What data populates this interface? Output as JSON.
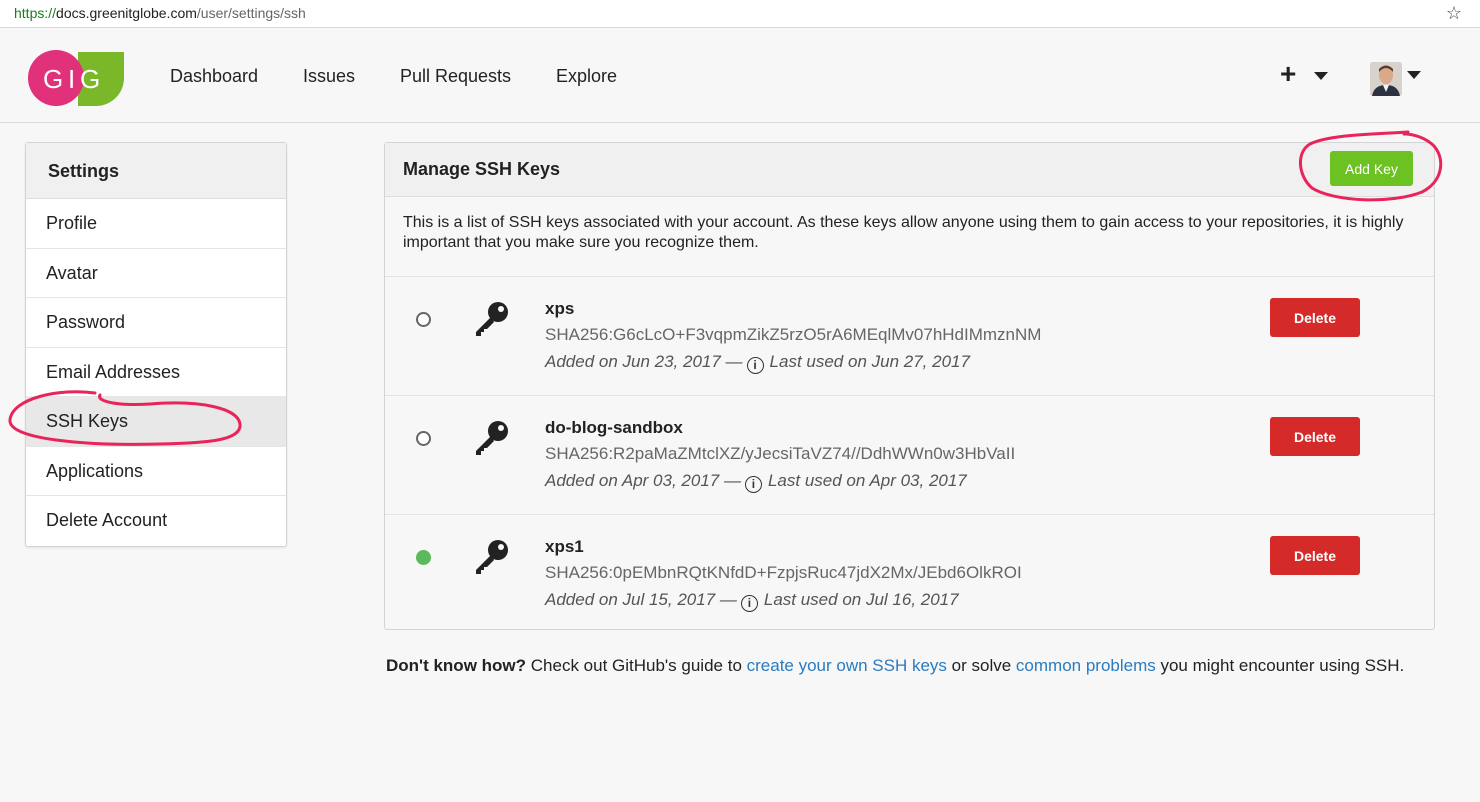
{
  "browser": {
    "url_scheme": "https://",
    "url_host": "docs.greenitglobe.com",
    "url_path": "/user/settings/ssh"
  },
  "nav": {
    "logo_text": "GIG",
    "items": [
      "Dashboard",
      "Issues",
      "Pull Requests",
      "Explore"
    ],
    "plus_label": "+"
  },
  "sidebar": {
    "title": "Settings",
    "items": [
      {
        "label": "Profile"
      },
      {
        "label": "Avatar"
      },
      {
        "label": "Password"
      },
      {
        "label": "Email Addresses"
      },
      {
        "label": "SSH Keys",
        "active": true
      },
      {
        "label": "Applications"
      },
      {
        "label": "Delete Account"
      }
    ]
  },
  "main": {
    "title": "Manage SSH Keys",
    "add_button": "Add Key",
    "description": "This is a list of SSH keys associated with your account. As these keys allow anyone using them to gain access to your repositories, it is highly important that you make sure you recognize them.",
    "keys": [
      {
        "name": "xps",
        "fingerprint": "SHA256:G6cLcO+F3vqpmZikZ5rzO5rA6MEqlMv07hHdIMmznNM",
        "added": "Added on Jun 23, 2017 —",
        "last_used": "Last used on Jun 27, 2017",
        "active": false,
        "delete_label": "Delete"
      },
      {
        "name": "do-blog-sandbox",
        "fingerprint": "SHA256:R2paMaZMtclXZ/yJecsiTaVZ74//DdhWWn0w3HbVaII",
        "added": "Added on Apr 03, 2017 —",
        "last_used": "Last used on Apr 03, 2017",
        "active": false,
        "delete_label": "Delete"
      },
      {
        "name": "xps1",
        "fingerprint": "SHA256:0pEMbnRQtKNfdD+FzpjsRuc47jdX2Mx/JEbd6OlkROI",
        "added": "Added on Jul 15, 2017 —",
        "last_used": "Last used on Jul 16, 2017",
        "active": true,
        "delete_label": "Delete"
      }
    ]
  },
  "help": {
    "lead": "Don't know how?",
    "text1": " Check out GitHub's guide to ",
    "link1": "create your own SSH keys",
    "text2": " or solve ",
    "link2": "common problems",
    "text3": " you might encounter using SSH."
  },
  "colors": {
    "accent_green": "#6cc223",
    "danger_red": "#d42a2a",
    "link_blue": "#2a7bbf",
    "logo_pink": "#e0317a",
    "logo_green": "#7ab82a",
    "annotation": "#e8245a"
  }
}
